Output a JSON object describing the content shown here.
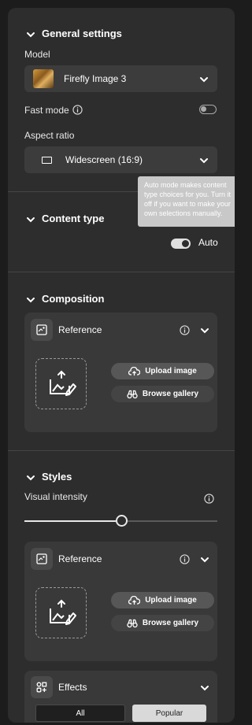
{
  "general": {
    "title": "General settings",
    "model_label": "Model",
    "model_value": "Firefly Image 3",
    "fast_mode_label": "Fast mode",
    "aspect_label": "Aspect ratio",
    "aspect_value": "Widescreen (16:9)",
    "tooltip": "Auto mode makes content type choices for you. Turn it off if you want to make your own selections manually."
  },
  "content_type": {
    "title": "Content type",
    "toggle_label": "Auto"
  },
  "composition": {
    "title": "Composition",
    "reference_label": "Reference",
    "upload_label": "Upload image",
    "browse_label": "Browse gallery"
  },
  "styles": {
    "title": "Styles",
    "intensity_label": "Visual intensity",
    "intensity_level": 0.5,
    "reference_label": "Reference",
    "upload_label": "Upload image",
    "browse_label": "Browse gallery",
    "effects_label": "Effects",
    "tabs": [
      "All",
      "Popular"
    ]
  },
  "colors": {
    "panel_bg": "#2d2d2d",
    "card_bg": "#393939",
    "toggle_on": "#e0e0e0"
  }
}
